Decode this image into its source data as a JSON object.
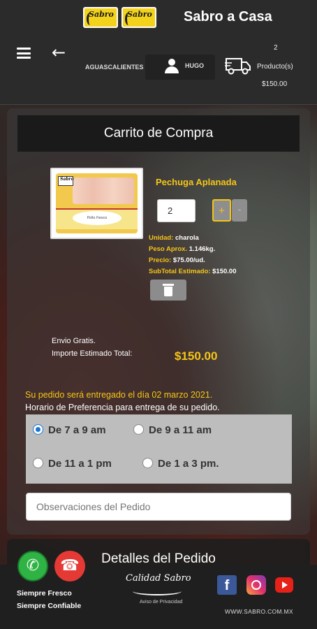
{
  "header": {
    "title": "Sabro a Casa",
    "logo_text": "Sabro",
    "location": "AGUASCALIENTES",
    "user": "HUGO",
    "cart_count": "2",
    "cart_label": "Producto(s)",
    "cart_total": "$150.00"
  },
  "cart": {
    "title": "Carrito de Compra",
    "product": {
      "name": "Pechuga Aplanada",
      "quantity": "2",
      "plus": "+",
      "minus": "-",
      "unit_label": "Unidad:",
      "unit_value": "charola",
      "weight_label": "Peso Aprox.",
      "weight_value": "1.146kg.",
      "price_label": "Precio:",
      "price_value": "$75.00/ud.",
      "subtotal_label": "SubTotal Estimado:",
      "subtotal_value": "$150.00",
      "image_logo": "Sabro",
      "image_band": "Pollo fresco"
    },
    "shipping": "Envio Gratis.",
    "total_label": "Importe Estimado Total:",
    "total_value": "$150.00",
    "delivery_msg": "Su pedido será entregado el día 02 marzo 2021.",
    "preference_msg": "Horario de Preferencia para entrega de su pedido.",
    "slots": [
      {
        "label": "De 7 a 9 am",
        "selected": true
      },
      {
        "label": "De 9 a 11 am",
        "selected": false
      },
      {
        "label": "De 11 a 1 pm",
        "selected": false
      },
      {
        "label": "De 1 a 3 pm.",
        "selected": false
      }
    ],
    "observations_placeholder": "Observaciones del Pedido"
  },
  "details": {
    "title": "Detalles del Pedido"
  },
  "footer": {
    "tagline1": "Siempre Fresco",
    "tagline2": "Siempre Confiable",
    "quality": "Calidad Sabro",
    "privacy": "Aviso de Privacidad",
    "facebook": "f",
    "website": "WWW.SABRO.COM.MX"
  },
  "colors": {
    "accent": "#f5c518",
    "header_bg": "#2b2b2b",
    "selected_radio": "#1976d2"
  }
}
